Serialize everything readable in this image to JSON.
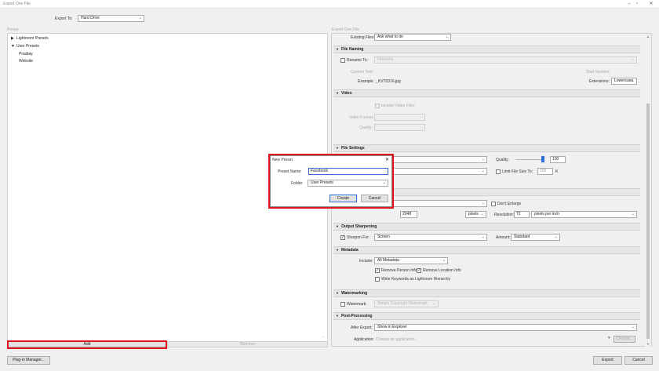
{
  "window": {
    "title": "Export One File"
  },
  "export_to": {
    "label": "Export To:",
    "value": "Hard Drive"
  },
  "left_panel": {
    "header": "Preset:",
    "presets": [
      {
        "label": "Lightroom Presets",
        "expander": "▶"
      },
      {
        "label": "User Presets",
        "expander": "▼"
      }
    ],
    "children": [
      "Pixabay",
      "Website"
    ],
    "add_label": "Add",
    "remove_label": "Remove"
  },
  "right_panel": {
    "header": "Export One File",
    "existing_files": {
      "label": "Existing Files:",
      "value": "Ask what to do"
    },
    "file_naming": {
      "title": "File Naming",
      "rename_label": "Rename To:",
      "rename_value": "Filename",
      "custom_text_label": "Custom Text:",
      "start_number_label": "Start Number:",
      "example_label": "Example:",
      "example_value": "_KVT0316.jpg",
      "extensions_label": "Extensions:",
      "extensions_value": "Lowercase"
    },
    "video": {
      "title": "Video",
      "include_label": "Include Video Files:",
      "format_label": "Video Format:",
      "quality_label": "Quality:"
    },
    "file_settings": {
      "title": "File Settings",
      "quality_label": "Quality:",
      "quality_value": "100",
      "quality_level": 1.0,
      "limit_label": "Limit File Size To:",
      "limit_value": "100",
      "limit_unit": "K"
    },
    "image_sizing": {
      "dont_enlarge_label": "Don't Enlarge",
      "size_value": "2048",
      "units_value": "pixels",
      "resolution_label": "Resolution:",
      "resolution_value": "72",
      "resolution_unit": "pixels per inch"
    },
    "output_sharpening": {
      "title": "Output Sharpening",
      "sharpen_label": "Sharpen For:",
      "sharpen_value": "Screen",
      "amount_label": "Amount:",
      "amount_value": "Standard"
    },
    "metadata": {
      "title": "Metadata",
      "include_label": "Include:",
      "include_value": "All Metadata",
      "remove_person": "Remove Person Info",
      "remove_location": "Remove Location Info",
      "write_keywords": "Write Keywords as Lightroom Hierarchy"
    },
    "watermarking": {
      "title": "Watermarking",
      "watermark_label": "Watermark:",
      "watermark_value": "Simple Copyright Watermark"
    },
    "post_processing": {
      "title": "Post-Processing",
      "after_export_label": "After Export:",
      "after_export_value": "Show in Explorer",
      "application_label": "Application:",
      "application_placeholder": "Choose an application...",
      "choose_label": "Choose..."
    }
  },
  "footer": {
    "plugin_manager": "Plug-in Manager...",
    "export": "Export",
    "cancel": "Cancel"
  },
  "dialog": {
    "title": "New Preset",
    "preset_name_label": "Preset Name:",
    "preset_name_value": "Facebook",
    "folder_label": "Folder:",
    "folder_value": "User Presets",
    "create": "Create",
    "cancel": "Cancel"
  }
}
